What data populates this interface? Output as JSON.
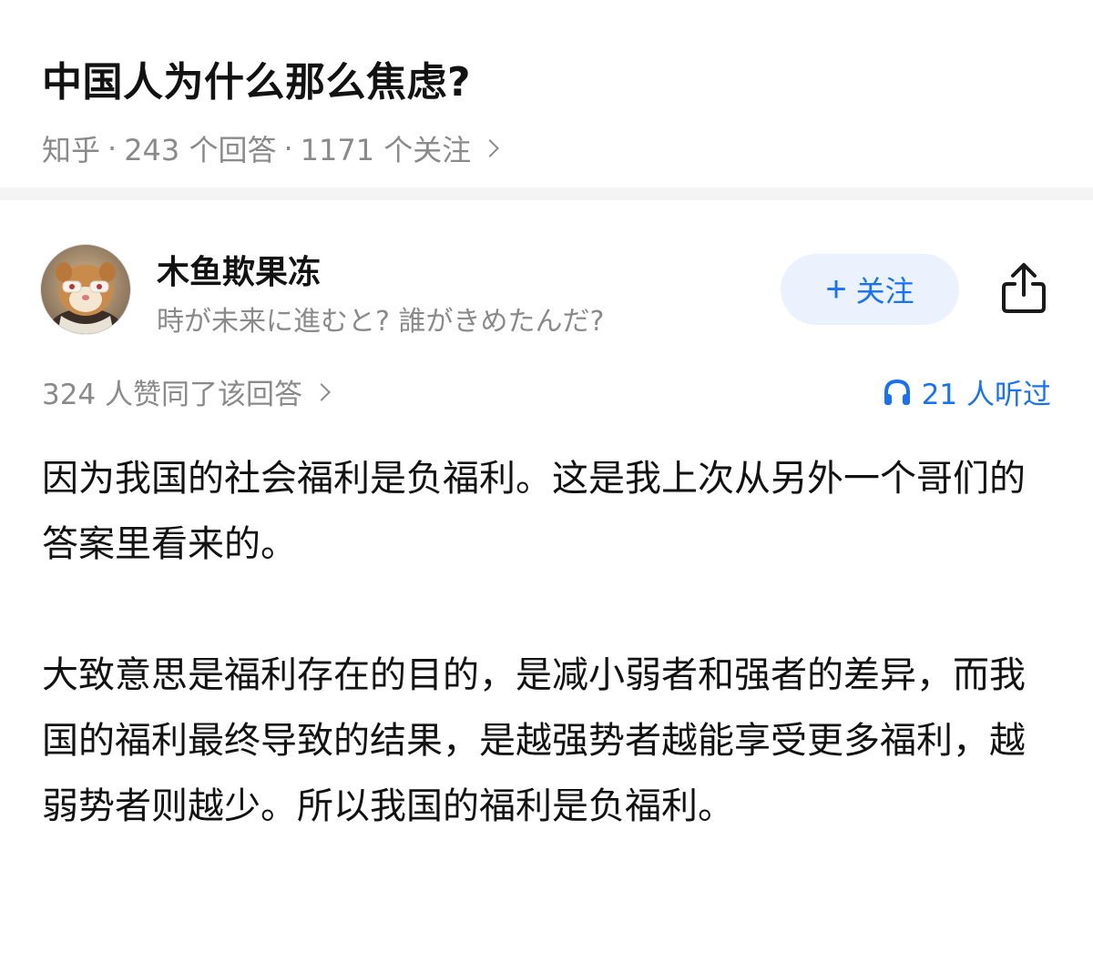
{
  "question": {
    "title": "中国人为什么那么焦虑?",
    "source": "知乎",
    "separator": "·",
    "answers_count": "243 个回答",
    "followers_count": "1171 个关注"
  },
  "author": {
    "name": "木鱼欺果冻",
    "bio": "時が未来に進むと? 誰がきめたんだ?"
  },
  "actions": {
    "follow_plus": "+",
    "follow_label": "关注",
    "share_icon": "share-icon"
  },
  "stats": {
    "upvotes": "324 人赞同了该回答",
    "listens": "21 人听过"
  },
  "content": {
    "paragraphs": [
      "因为我国的社会福利是负福利。这是我上次从另外一个哥们的答案里看来的。",
      "大致意思是福利存在的目的，是减小弱者和强者的差异，而我国的福利最终导致的结果，是越强势者越能享受更多福利，越弱势者则越少。所以我国的福利是负福利。"
    ]
  },
  "colors": {
    "accent": "#1772f6",
    "follow_bg": "#ebf2fd",
    "meta_gray": "#8a8a8a",
    "divider": "#f4f4f5"
  }
}
